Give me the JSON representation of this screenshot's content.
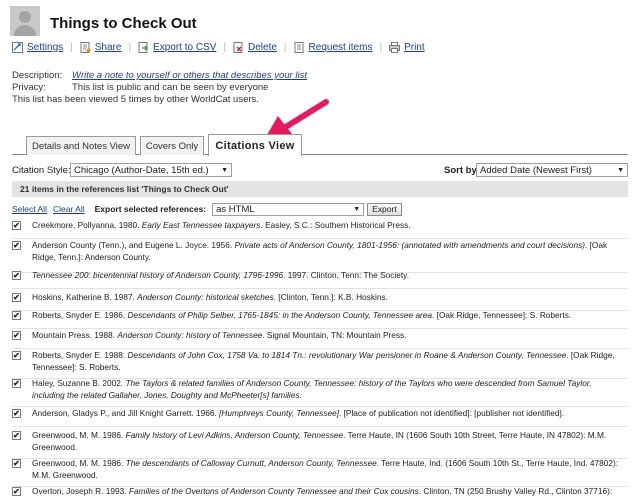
{
  "list": {
    "title": "Things to Check Out"
  },
  "toolbar": [
    {
      "label": "Settings",
      "icon": "settings-icon"
    },
    {
      "label": "Share",
      "icon": "share-icon"
    },
    {
      "label": "Export to CSV",
      "icon": "export-icon"
    },
    {
      "label": "Delete",
      "icon": "delete-icon"
    },
    {
      "label": "Request items",
      "icon": "request-icon"
    },
    {
      "label": "Print",
      "icon": "print-icon"
    }
  ],
  "meta": {
    "description_label": "Description:",
    "description_link": "Write a note to yourself or others that describes your list",
    "privacy_label": "Privacy:",
    "privacy_value": "This list is public and can be seen by everyone",
    "views_text": "This list has been viewed 5 times by other WorldCat users."
  },
  "tabs": [
    {
      "label": "Details and Notes View",
      "active": false
    },
    {
      "label": "Covers Only",
      "active": false
    },
    {
      "label": "Citations View",
      "active": true
    }
  ],
  "controls": {
    "citation_style_label": "Citation Style:",
    "citation_style_value": "Chicago (Author-Date, 15th ed.)",
    "sort_label": "Sort by:",
    "sort_value": "Added Date (Newest First)"
  },
  "count_text": "21 items in the references list 'Things to Check Out'",
  "actions": {
    "select_all": "Select All",
    "clear_all": "Clear All",
    "export_label": "Export selected references:",
    "export_format": "as HTML",
    "export_button": "Export"
  },
  "citations": [
    {
      "checked": true,
      "parts": [
        {
          "t": "Creekmore, Pollyanna. 1980. "
        },
        {
          "t": "Early East Tennessee taxpayers",
          "i": true
        },
        {
          "t": ". Easley, S.C.: Southern Historical Press."
        }
      ]
    },
    {
      "checked": true,
      "parts": [
        {
          "t": "Anderson County (Tenn.), and Eugene L. Joyce. 1956. "
        },
        {
          "t": "Private acts of Anderson County, 1801-1956: (annotated with amendments and court decisions)",
          "i": true
        },
        {
          "t": ". [Oak Ridge, Tenn.]: Anderson County."
        }
      ]
    },
    {
      "checked": true,
      "parts": [
        {
          "t": "Tennessee 200: bicentennial history of Anderson County, 1796-1996",
          "i": true
        },
        {
          "t": ". 1997. Clinton, Tenn: The Society."
        }
      ]
    },
    {
      "checked": true,
      "parts": [
        {
          "t": "Hoskins, Katherine B. 1987. "
        },
        {
          "t": "Anderson County: historical sketches",
          "i": true
        },
        {
          "t": ". [Clinton, Tenn.]: K.B. Hoskins."
        }
      ]
    },
    {
      "checked": true,
      "parts": [
        {
          "t": "Roberts, Snyder E. 1986. "
        },
        {
          "t": "Descendants of Philip Selber, 1765-1845: in the Anderson County, Tennessee area",
          "i": true
        },
        {
          "t": ". [Oak Ridge, Tennessee]: S. Roberts."
        }
      ]
    },
    {
      "checked": true,
      "parts": [
        {
          "t": "Mountain Press. 1988. "
        },
        {
          "t": "Anderson County: history of Tennessee",
          "i": true
        },
        {
          "t": ". Signal Mountain, TN: Mountain Press."
        }
      ]
    },
    {
      "checked": true,
      "parts": [
        {
          "t": "Roberts, Snyder E. 1988. "
        },
        {
          "t": "Descendants of John Cox, 1758 Va. to 1814 Tn.: revolutionary War pensioner in Roane & Anderson County, Tennessee",
          "i": true
        },
        {
          "t": ". [Oak Ridge, Tennessee]: S. Roberts."
        }
      ]
    },
    {
      "checked": true,
      "parts": [
        {
          "t": "Haley, Suzanne B. 2002. "
        },
        {
          "t": "The Taylors & related families of Anderson County, Tennessee: history of the Taylors who were descended from Samuel Taylor, including the related Gallaher, Jones, Doughty and McPheeter[s] families",
          "i": true
        },
        {
          "t": "."
        }
      ]
    },
    {
      "checked": true,
      "parts": [
        {
          "t": "Anderson, Gladys P., and Jill Knight Garrett. 1966. "
        },
        {
          "t": "[Humphreys County, Tennessee]",
          "i": true
        },
        {
          "t": ". [Place of publication not identified]: [publisher not identified]."
        }
      ]
    },
    {
      "checked": true,
      "parts": [
        {
          "t": "Greenwood, M. M. 1986. "
        },
        {
          "t": "Family history of Levi Adkins, Anderson County, Tennessee",
          "i": true
        },
        {
          "t": ". Terre Haute, IN (1606 South 10th Street, Terre Haute, IN 47802): M.M. Greenwood."
        }
      ]
    },
    {
      "checked": true,
      "parts": [
        {
          "t": "Greenwood, M. M. 1986. "
        },
        {
          "t": "The descendants of Calloway Curnutt, Anderson County, Tennessee",
          "i": true
        },
        {
          "t": ". Terre Haute, Ind. (1606 South 10th St., Terre Haute, Ind. 47802): M.M. Greenwood."
        }
      ]
    },
    {
      "checked": true,
      "parts": [
        {
          "t": "Overton, Joseph R. 1993. "
        },
        {
          "t": "Families of the Overtons of Anderson County Tennessee and their Cox cousins",
          "i": true
        },
        {
          "t": ". Clinton, TN (250 Brushy Valley Rd., Clinton 37716): J.R. Overton."
        }
      ]
    }
  ]
}
